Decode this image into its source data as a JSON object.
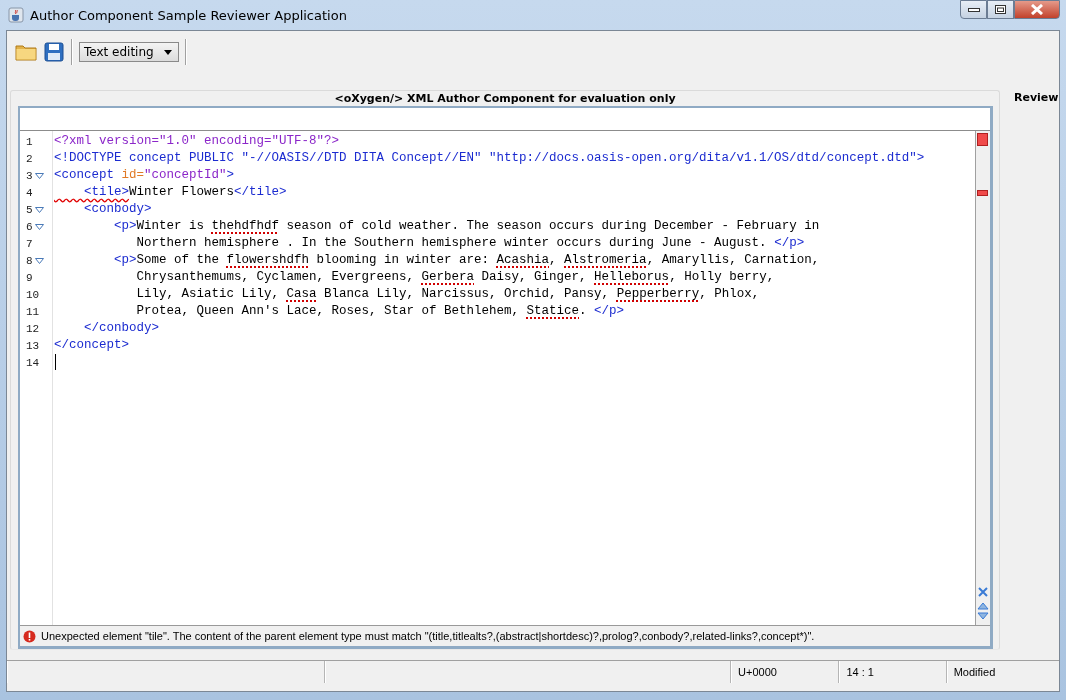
{
  "window": {
    "title": "Author Component Sample Reviewer Application"
  },
  "toolbar": {
    "mode_dropdown": "Text editing"
  },
  "editor": {
    "header": "<oXygen/> XML Author Component for evaluation only",
    "lines": [
      {
        "number": "1",
        "foldable": false,
        "tokens": [
          {
            "t": "<?xml version=\"1.0\" encoding=\"UTF-8\"?>",
            "kind": "pi"
          }
        ]
      },
      {
        "number": "2",
        "foldable": false,
        "tokens": [
          {
            "t": "<!DOCTYPE concept PUBLIC \"-//OASIS//DTD DITA Concept//EN\" \"http://docs.oasis-open.org/dita/v1.1/OS/dtd/concept.dtd\">",
            "kind": "decl"
          }
        ]
      },
      {
        "number": "3",
        "foldable": true,
        "tokens": [
          {
            "t": "<concept ",
            "kind": "tag"
          },
          {
            "t": "id=",
            "kind": "attr"
          },
          {
            "t": "\"conceptId\"",
            "kind": "value"
          },
          {
            "t": ">",
            "kind": "tag"
          }
        ]
      },
      {
        "number": "4",
        "foldable": false,
        "tokens": [
          {
            "t": "    <tile>",
            "kind": "invalid"
          },
          {
            "t": "Winter Flowers",
            "kind": "text"
          },
          {
            "t": "</tile>",
            "kind": "tag"
          }
        ]
      },
      {
        "number": "5",
        "foldable": true,
        "tokens": [
          {
            "t": "    <conbody>",
            "kind": "tag"
          }
        ]
      },
      {
        "number": "6",
        "foldable": true,
        "tokens": [
          {
            "t": "        <p>",
            "kind": "tag"
          },
          {
            "t": "Winter is ",
            "kind": "text"
          },
          {
            "t": "thehdfhdf",
            "kind": "misspelled"
          },
          {
            "t": " season of cold weather. The season occurs during December - February in",
            "kind": "text"
          }
        ]
      },
      {
        "number": "7",
        "foldable": false,
        "tokens": [
          {
            "t": "           Northern hemisphere . In the Southern hemisphere winter occurs during June - August. ",
            "kind": "text"
          },
          {
            "t": "</p>",
            "kind": "tag"
          }
        ]
      },
      {
        "number": "8",
        "foldable": true,
        "tokens": [
          {
            "t": "        <p>",
            "kind": "tag"
          },
          {
            "t": "Some of the ",
            "kind": "text"
          },
          {
            "t": "flowershdfh",
            "kind": "misspelled"
          },
          {
            "t": " blooming in winter are: ",
            "kind": "text"
          },
          {
            "t": "Acashia",
            "kind": "misspelled"
          },
          {
            "t": ", ",
            "kind": "text"
          },
          {
            "t": "Alstromeria",
            "kind": "misspelled"
          },
          {
            "t": ", Amaryllis, Carnation,",
            "kind": "text"
          }
        ]
      },
      {
        "number": "9",
        "foldable": false,
        "tokens": [
          {
            "t": "           Chrysanthemums, Cyclamen, Evergreens, ",
            "kind": "text"
          },
          {
            "t": "Gerbera",
            "kind": "misspelled"
          },
          {
            "t": " Daisy, Ginger, ",
            "kind": "text"
          },
          {
            "t": "Helleborus",
            "kind": "misspelled"
          },
          {
            "t": ", Holly berry,",
            "kind": "text"
          }
        ]
      },
      {
        "number": "10",
        "foldable": false,
        "tokens": [
          {
            "t": "           Lily, Asiatic Lily, ",
            "kind": "text"
          },
          {
            "t": "Casa",
            "kind": "misspelled"
          },
          {
            "t": " Blanca Lily, Narcissus, Orchid, Pansy, ",
            "kind": "text"
          },
          {
            "t": "Pepperberry",
            "kind": "misspelled"
          },
          {
            "t": ", Phlox,",
            "kind": "text"
          }
        ]
      },
      {
        "number": "11",
        "foldable": false,
        "tokens": [
          {
            "t": "           Protea, Queen Ann's Lace, Roses, Star of Bethlehem, ",
            "kind": "text"
          },
          {
            "t": "Statice",
            "kind": "misspelled"
          },
          {
            "t": ". ",
            "kind": "text"
          },
          {
            "t": "</p>",
            "kind": "tag"
          }
        ]
      },
      {
        "number": "12",
        "foldable": false,
        "tokens": [
          {
            "t": "    </conbody>",
            "kind": "tag"
          }
        ]
      },
      {
        "number": "13",
        "foldable": false,
        "tokens": [
          {
            "t": "</concept>",
            "kind": "tag"
          }
        ]
      },
      {
        "number": "14",
        "foldable": false
      }
    ],
    "error_message": "Unexpected element \"tile\". The content of the parent element type must match \"(title,titlealts?,(abstract|shortdesc)?,prolog?,conbody?,related-links?,concept*)\"."
  },
  "side_panel": {
    "title": "Review"
  },
  "status_bar": {
    "encoding": "U+0000",
    "position": "14 : 1",
    "state": "Modified"
  }
}
